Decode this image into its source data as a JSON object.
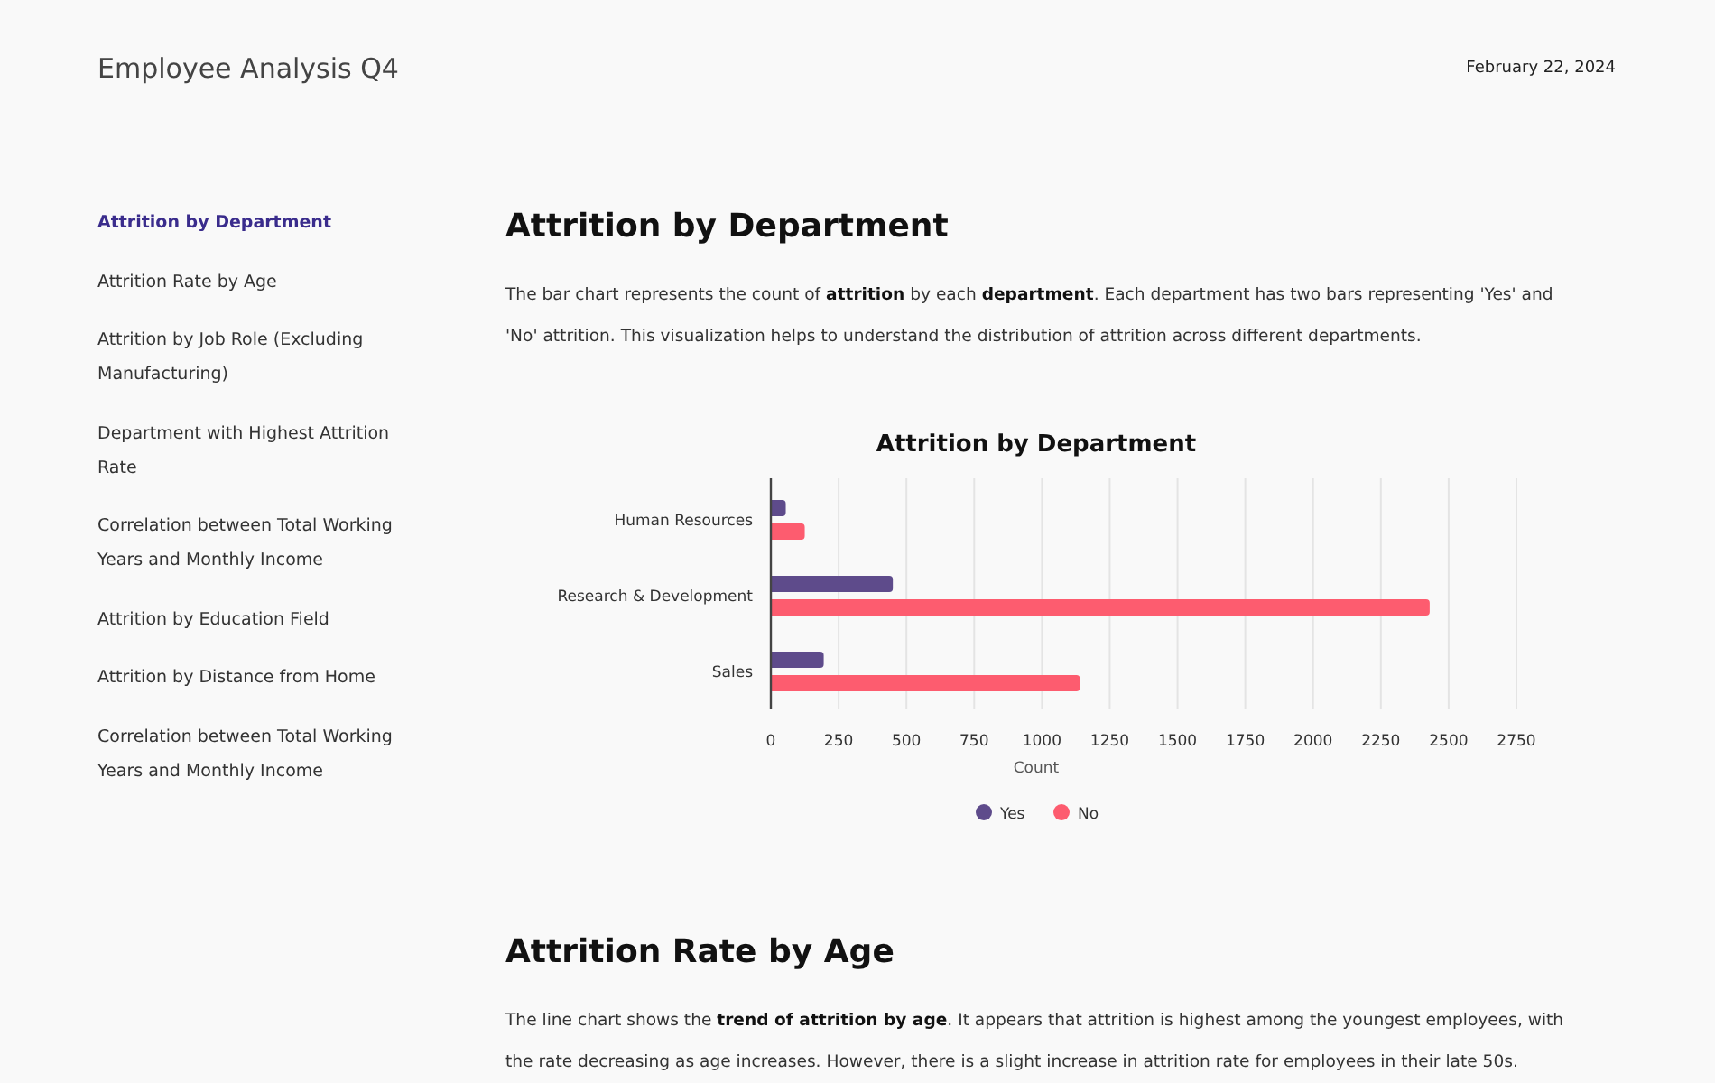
{
  "header": {
    "title": "Employee Analysis Q4",
    "date": "February 22, 2024"
  },
  "sidebar": {
    "items": [
      {
        "label": "Attrition by Department",
        "selected": true
      },
      {
        "label": "Attrition Rate by Age",
        "selected": false
      },
      {
        "label": "Attrition by Job Role (Excluding Manufacturing)",
        "selected": false
      },
      {
        "label": "Department with Highest Attrition Rate",
        "selected": false
      },
      {
        "label": "Correlation between Total Working Years and Monthly Income",
        "selected": false
      },
      {
        "label": "Attrition by Education Field",
        "selected": false
      },
      {
        "label": "Attrition by Distance from Home",
        "selected": false
      },
      {
        "label": "Correlation between Total Working Years and Monthly Income",
        "selected": false
      }
    ]
  },
  "sections": [
    {
      "heading": "Attrition by Department",
      "text": "The bar chart represents the count of **attrition** by each **department**. Each department has two bars representing 'Yes' and 'No' attrition. This visualization helps to understand the distribution of attrition across different departments.",
      "chart_data": {
        "type": "bar",
        "orientation": "horizontal",
        "title": "Attrition by Department",
        "xlabel": "Count",
        "categories": [
          "Human Resources",
          "Research & Development",
          "Sales"
        ],
        "series": [
          {
            "name": "Yes",
            "color": "#5e4b8b",
            "values": [
              55,
              450,
              195
            ]
          },
          {
            "name": "No",
            "color": "#fd5c6f",
            "values": [
              125,
              2430,
              1140
            ]
          }
        ],
        "xlim": [
          0,
          2750
        ],
        "xticks": [
          0,
          250,
          500,
          750,
          1000,
          1250,
          1500,
          1750,
          2000,
          2250,
          2500,
          2750
        ],
        "grid": true,
        "legend": true
      }
    },
    {
      "heading": "Attrition Rate by Age",
      "text": "The line chart shows the **trend of attrition by age**. It appears that attrition is highest among the youngest employees, with the rate decreasing as age increases. However, there is a slight increase in attrition rate for employees in their late 50s."
    }
  ]
}
